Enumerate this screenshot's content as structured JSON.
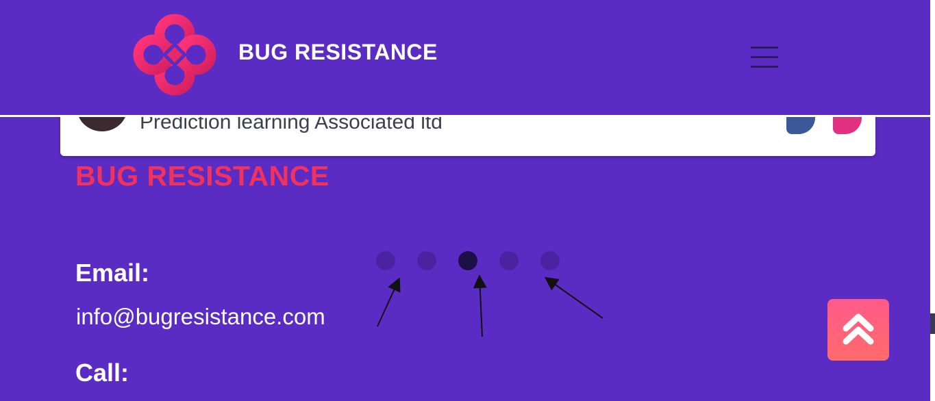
{
  "header": {
    "brand": "BUG RESISTANCE",
    "logo_icon": "four-loop-knot-logo",
    "menu_icon": "hamburger-menu-icon",
    "brand_color": "#ec2d6f"
  },
  "card": {
    "text": "Prediction learning Associated ltd",
    "social": [
      "facebook-icon",
      "instagram-icon"
    ]
  },
  "company": {
    "name": "BUG RESISTANCE",
    "color": "#f0325c"
  },
  "contact": {
    "email_label": "Email:",
    "email_value": "info@bugresistance.com",
    "call_label": "Call:"
  },
  "carousel": {
    "dot_count": 5,
    "active_index": 3
  },
  "scroll_top": {
    "icon": "double-chevron-up-icon"
  },
  "colors": {
    "background": "#5b2cc4",
    "accent": "#f0325c",
    "dot": "#4a24a0",
    "dot_active": "#1c0f45"
  }
}
